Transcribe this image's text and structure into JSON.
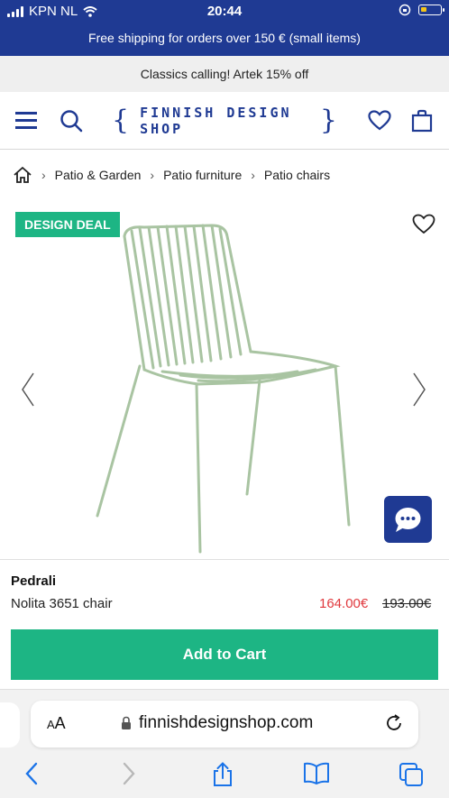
{
  "status_bar": {
    "carrier": "KPN NL",
    "time": "20:44"
  },
  "shipping_banner": "Free shipping for orders over 150 € (small items)",
  "promo_banner": "Classics calling! Artek 15% off",
  "header": {
    "logo_text": "FINNISH DESIGN SHOP",
    "icons": [
      "menu-icon",
      "search-icon",
      "heart-icon",
      "bag-icon"
    ]
  },
  "breadcrumb": {
    "items": [
      "Patio & Garden",
      "Patio furniture",
      "Patio chairs"
    ]
  },
  "product": {
    "badge": "DESIGN DEAL",
    "brand": "Pedrali",
    "name": "Nolita 3651 chair",
    "price_sale": "164.00€",
    "price_original": "193.00€",
    "chair_color": "#a9c4a2"
  },
  "cart_button": "Add to Cart",
  "browser": {
    "text_size_label_small": "A",
    "text_size_label_large": "A",
    "url": "finnishdesignshop.com"
  },
  "colors": {
    "brand_blue": "#1f3a93",
    "accent_green": "#1db584",
    "sale_red": "#e0393e"
  }
}
